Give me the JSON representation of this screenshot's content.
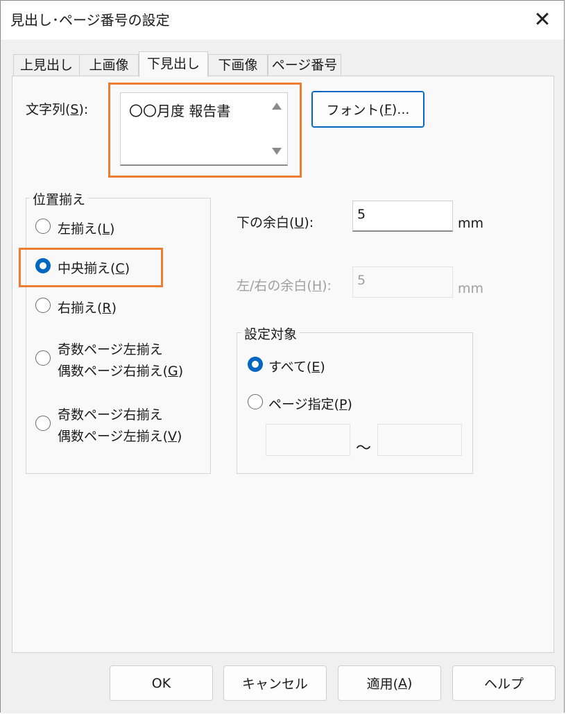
{
  "window": {
    "title": "見出し･ページ番号の設定"
  },
  "tabs": [
    {
      "label": "上見出し"
    },
    {
      "label": "上画像"
    },
    {
      "label": "下見出し"
    },
    {
      "label": "下画像"
    },
    {
      "label": "ページ番号"
    }
  ],
  "string_field": {
    "label": "文字列(",
    "label_key": "S",
    "label_end": "):",
    "value": "〇〇月度 報告書"
  },
  "font_button": {
    "label": "フォント(",
    "key": "F",
    "end": ")..."
  },
  "alignment": {
    "title": "位置揃え",
    "options": [
      {
        "text": "左揃え(",
        "key": "L",
        "end": ")"
      },
      {
        "text": "中央揃え(",
        "key": "C",
        "end": ")"
      },
      {
        "text": "右揃え(",
        "key": "R",
        "end": ")"
      },
      {
        "line1": "奇数ページ左揃え",
        "text": "偶数ページ右揃え(",
        "key": "G",
        "end": ")"
      },
      {
        "line1": "奇数ページ右揃え",
        "text": "偶数ページ左揃え(",
        "key": "V",
        "end": ")"
      }
    ],
    "selected": "中央揃え(C)"
  },
  "bottom_margin": {
    "label": "下の余白(",
    "key": "U",
    "end": "):",
    "value": "5",
    "unit": "mm"
  },
  "side_margin": {
    "label": "左/右の余白(",
    "key": "H",
    "end": "):",
    "value": "5",
    "unit": "mm"
  },
  "target": {
    "title": "設定対象",
    "all": {
      "text": "すべて(",
      "key": "E",
      "end": ")"
    },
    "page": {
      "text": "ページ指定(",
      "key": "P",
      "end": ")"
    },
    "range_sep": "～",
    "from": "",
    "to": ""
  },
  "footer": {
    "ok": "OK",
    "cancel": "キャンセル",
    "apply": "適用(",
    "apply_key": "A",
    "apply_end": ")",
    "help": "ヘルプ"
  },
  "colors": {
    "accent": "#0067c0",
    "highlight": "#ed7d31"
  }
}
